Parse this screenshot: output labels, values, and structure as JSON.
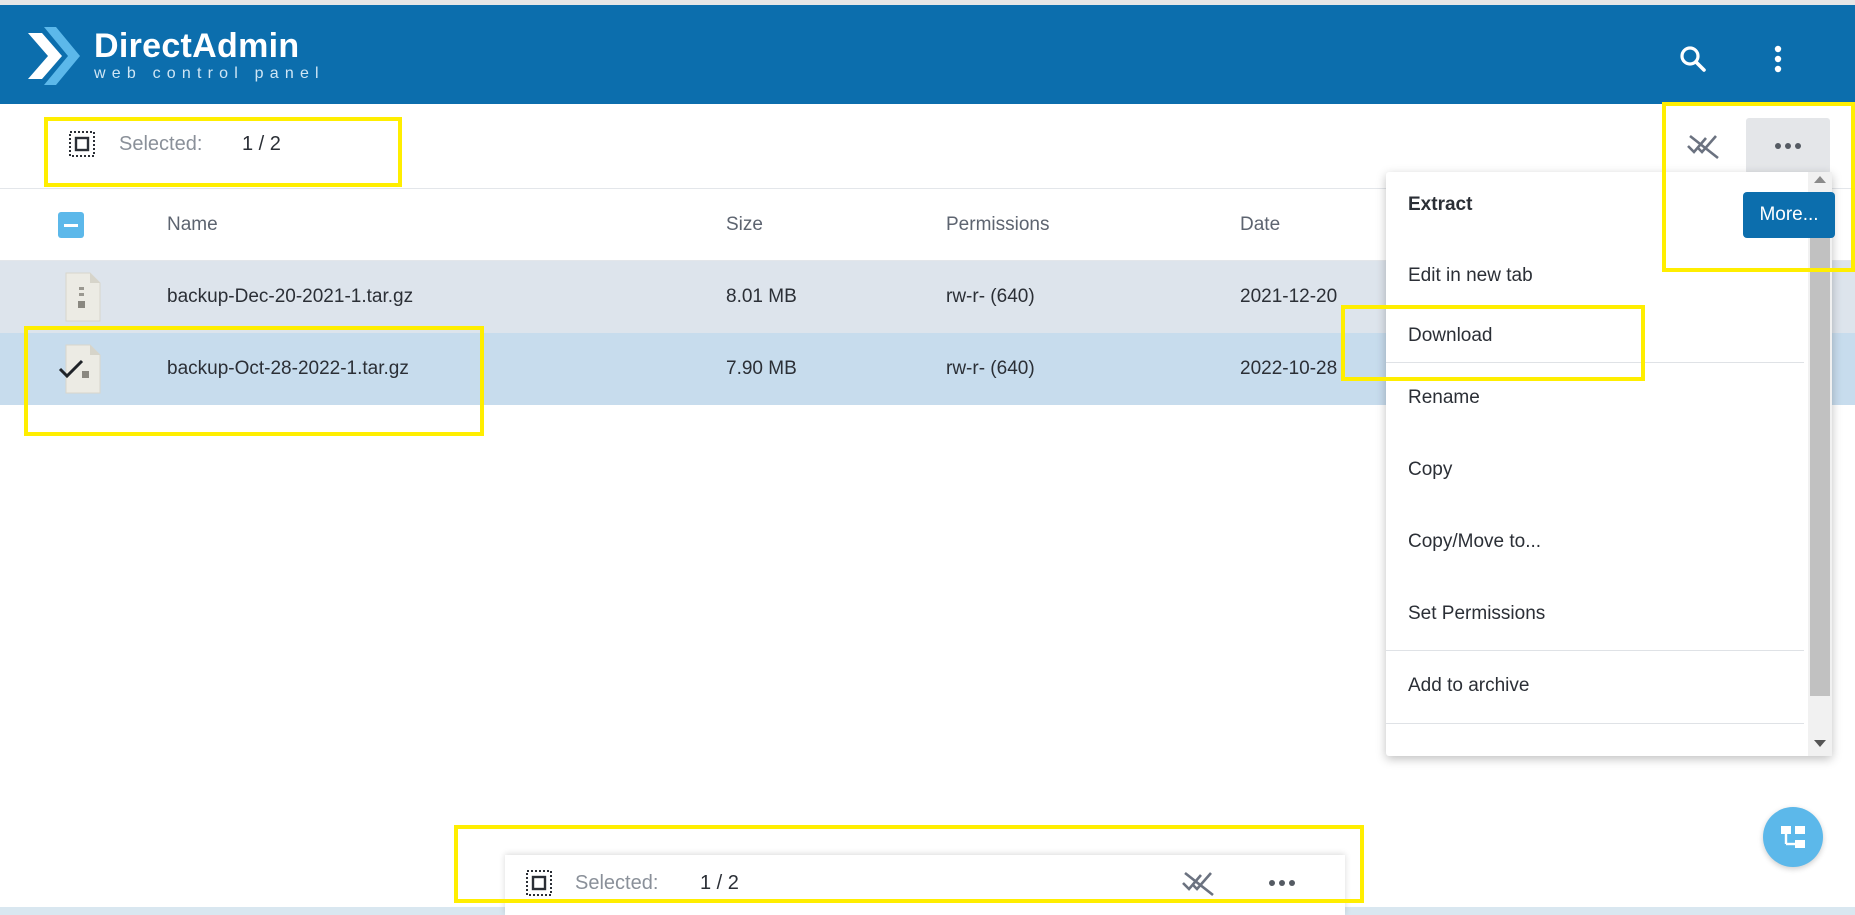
{
  "app": {
    "logo_title": "DirectAdmin",
    "logo_subtitle": "web control panel",
    "brand_color": "#0c6ead",
    "accent_color": "#5cb8ea"
  },
  "header": {
    "icons": [
      "search-icon",
      "more-vertical-icon"
    ]
  },
  "selection": {
    "label": "Selected:",
    "count": "1 / 2"
  },
  "table": {
    "columns": [
      "Name",
      "Size",
      "Permissions",
      "Date"
    ],
    "rows": [
      {
        "name": "backup-Dec-20-2021-1.tar.gz",
        "size": "8.01 MB",
        "permissions": "rw-r- (640)",
        "date": "2021-12-20",
        "selected": false
      },
      {
        "name": "backup-Oct-28-2022-1.tar.gz",
        "size": "7.90 MB",
        "permissions": "rw-r- (640)",
        "date": "2022-10-28",
        "selected": true
      }
    ]
  },
  "context_menu": {
    "items": [
      "Extract",
      "Edit in new tab",
      "Download",
      "Rename",
      "Copy",
      "Copy/Move to...",
      "Set Permissions",
      "Add to archive"
    ],
    "more_button": "More..."
  },
  "bottom_bar": {
    "label": "Selected:",
    "count": "1 / 2"
  },
  "highlight_color": "#ffee00"
}
